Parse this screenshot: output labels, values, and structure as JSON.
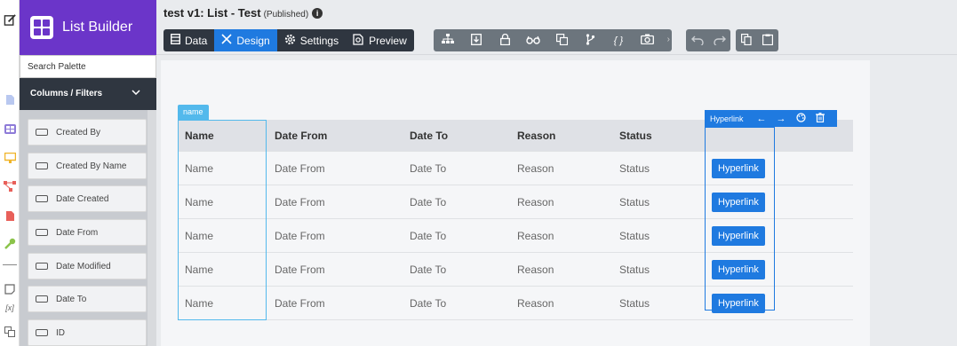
{
  "rail": {
    "icons": [
      "edit-icon",
      "document-icon",
      "grid-icon",
      "monitor-icon",
      "workflow-icon",
      "pdf-icon",
      "key-icon",
      "note-icon",
      "variable-icon",
      "translate-icon"
    ]
  },
  "palette": {
    "brand_title": "List Builder",
    "search_placeholder": "Search Palette",
    "section_title": "Columns / Filters",
    "items": [
      "Created By",
      "Created By Name",
      "Date Created",
      "Date From",
      "Date Modified",
      "Date To",
      "ID"
    ]
  },
  "header": {
    "title": "test v1: List - Test",
    "status": "(Published)",
    "tabs": [
      {
        "label": "Data",
        "icon": "grid-icon"
      },
      {
        "label": "Design",
        "icon": "design-icon"
      },
      {
        "label": "Settings",
        "icon": "gear-icon"
      },
      {
        "label": "Preview",
        "icon": "preview-icon"
      }
    ],
    "active_tab": "Design",
    "tools": [
      "tree-icon",
      "import-icon",
      "lock-icon",
      "glasses-icon",
      "translate-icon",
      "branch-icon",
      "braces-icon",
      "camera-icon"
    ],
    "braces_label": "{ }"
  },
  "grid": {
    "columns": [
      "Name",
      "Date From",
      "Date To",
      "Reason",
      "Status"
    ],
    "rows": [
      [
        "Name",
        "Date From",
        "Date To",
        "Reason",
        "Status",
        "Hyperlink"
      ],
      [
        "Name",
        "Date From",
        "Date To",
        "Reason",
        "Status",
        "Hyperlink"
      ],
      [
        "Name",
        "Date From",
        "Date To",
        "Reason",
        "Status",
        "Hyperlink"
      ],
      [
        "Name",
        "Date From",
        "Date To",
        "Reason",
        "Status",
        "Hyperlink"
      ],
      [
        "Name",
        "Date From",
        "Date To",
        "Reason",
        "Status",
        "Hyperlink"
      ]
    ],
    "selected_column_tag": "name",
    "hyperlink_toolbar_label": "Hyperlink"
  },
  "colors": {
    "brand": "#6b35c9",
    "accent": "#1f7ae0",
    "selection": "#53b9ec",
    "dark": "#2f3640"
  }
}
